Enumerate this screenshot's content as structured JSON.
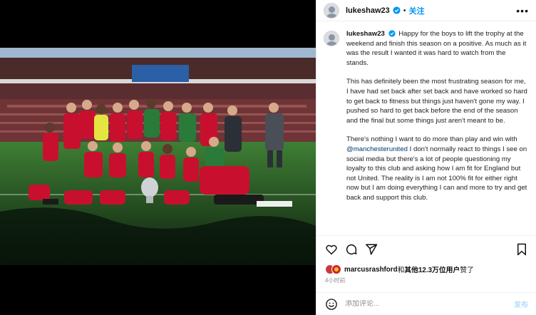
{
  "header": {
    "username": "lukeshaw23",
    "separator": "•",
    "follow_label": "关注",
    "more_icon": "more-horizontal-icon"
  },
  "caption": {
    "username": "lukeshaw23",
    "paragraphs": [
      "Happy for the boys to lift the trophy at the weekend and finish this season on a positive. As much as it was the result I wanted it was hard to watch from the stands.",
      "This has definitely been the most frustrating season for me, I have had set back after set back and have worked so hard to get back to fitness but things just haven't gone my way. I pushed so hard to get back before the end of the season and the final but some things just aren't meant to be."
    ],
    "p3_before": "There's nothing I want to do more than play and win with ",
    "p3_mention": "@manchesterunited",
    "p3_after": " I don't normally react to things I see on social media but there's a lot of people questioning my loyalty to this club and asking how I am fit for England but not United. The reality is I am not 100% fit for either right now but I am doing everything I can and more to try and get back and support this club."
  },
  "actions": {
    "like_icon": "heart-icon",
    "comment_icon": "comment-icon",
    "share_icon": "share-icon",
    "save_icon": "bookmark-icon"
  },
  "likes": {
    "name": "marcusrashford",
    "mid": "和",
    "count": "其他12.3万位用户",
    "suffix": "赞了"
  },
  "timestamp": "4小时前",
  "comment": {
    "placeholder": "添加评论...",
    "post_label": "发布"
  },
  "colors": {
    "accent": "#0095f6",
    "kit_red": "#c8102e",
    "pitch": "#2f6b2a"
  }
}
